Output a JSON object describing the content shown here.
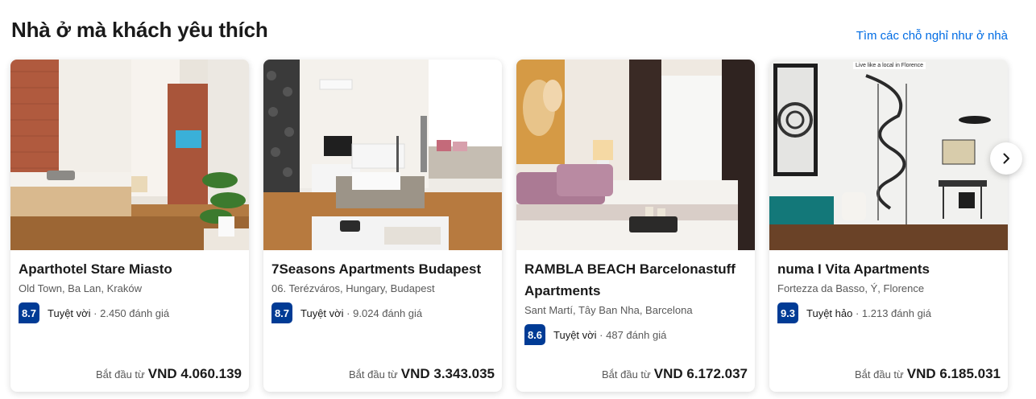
{
  "section": {
    "title": "Nhà ở mà khách yêu thích",
    "see_all": "Tìm các chỗ nghỉ như ở nhà"
  },
  "cards": [
    {
      "name": "Aparthotel Stare Miasto",
      "location": "Old Town, Ba Lan, Kraków",
      "score": "8.7",
      "rating_word": "Tuyệt vời",
      "reviews": "2.450 đánh giá",
      "price_prefix": "Bắt đầu từ",
      "price": "VND 4.060.139"
    },
    {
      "name": "7Seasons Apartments Budapest",
      "location": "06. Terézváros, Hungary, Budapest",
      "score": "8.7",
      "rating_word": "Tuyệt vời",
      "reviews": "9.024 đánh giá",
      "price_prefix": "Bắt đầu từ",
      "price": "VND 3.343.035"
    },
    {
      "name": "RAMBLA BEACH Barcelonastuff Apartments",
      "location": "Sant Martí, Tây Ban Nha, Barcelona",
      "score": "8.6",
      "rating_word": "Tuyệt vời",
      "reviews": "487 đánh giá",
      "price_prefix": "Bắt đầu từ",
      "price": "VND 6.172.037"
    },
    {
      "name": "numa I Vita Apartments",
      "location": "Fortezza da Basso, Ý, Florence",
      "score": "9.3",
      "rating_word": "Tuyệt hảo",
      "reviews": "1.213 đánh giá",
      "price_prefix": "Bắt đầu từ",
      "price": "VND 6.185.031",
      "photo_caption": "Live like a local in Florence"
    }
  ],
  "colors": {
    "link": "#006ce4",
    "score_badge": "#003b95"
  },
  "icons": {
    "next": "chevron-right-icon"
  }
}
